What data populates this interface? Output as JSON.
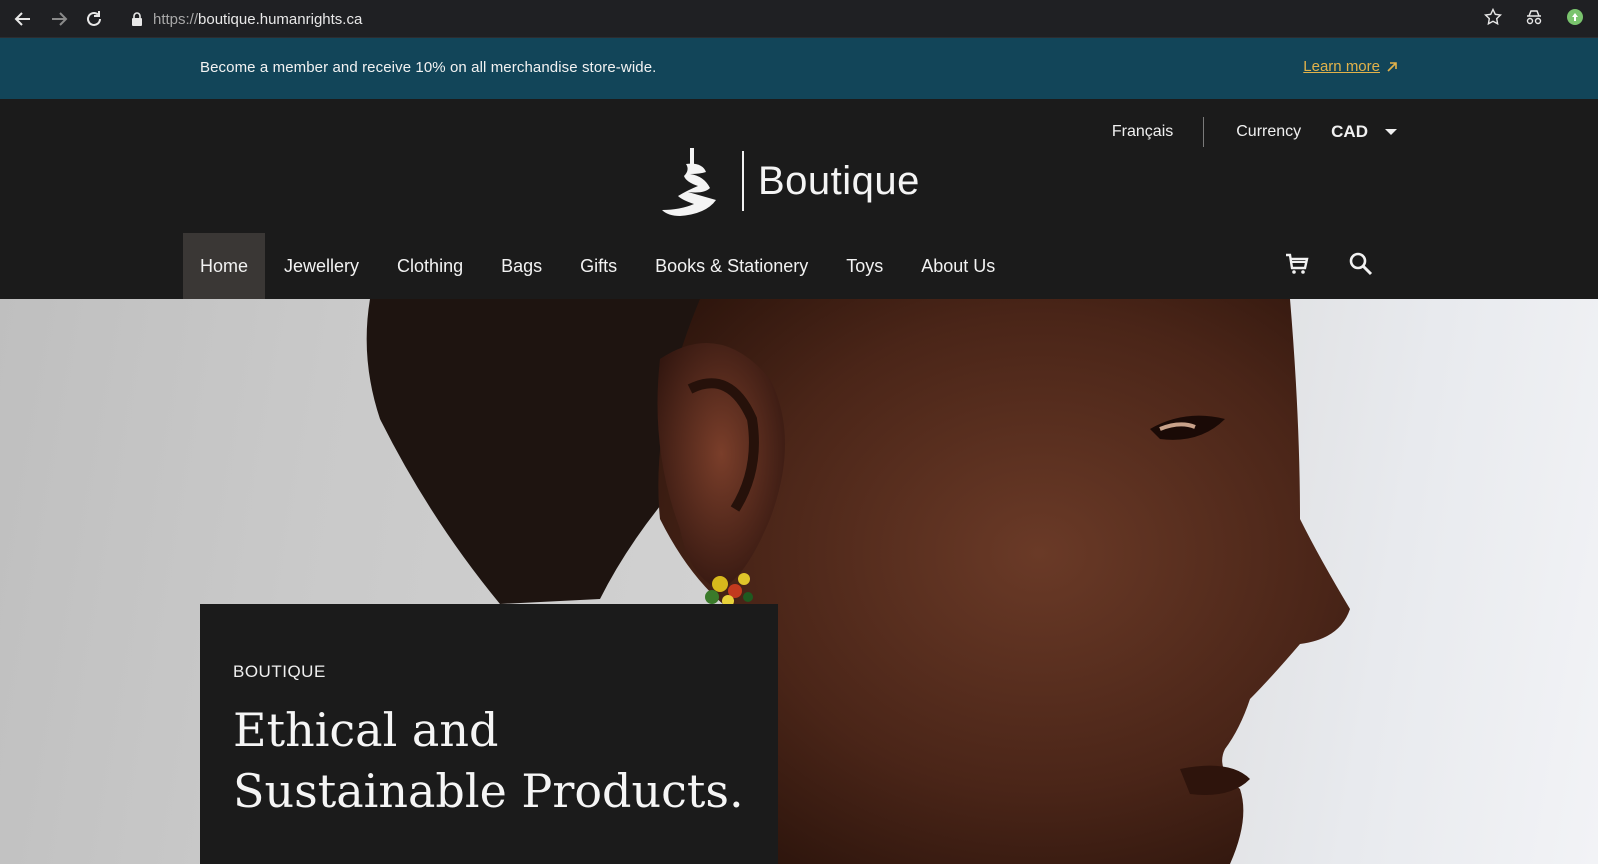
{
  "browser": {
    "url_scheme": "https://",
    "url_host": "boutique.humanrights.ca",
    "icons": [
      "back-icon",
      "forward-icon",
      "reload-icon",
      "lock-icon",
      "star-icon",
      "incognito-icon",
      "extension-icon"
    ]
  },
  "banner": {
    "message": "Become a member and receive 10% on all merchandise store-wide.",
    "link_label": "Learn more",
    "link_color": "#e2b24a",
    "background": "#124559"
  },
  "utility": {
    "language": "Français",
    "currency_label": "Currency",
    "currency_value": "CAD"
  },
  "logo": {
    "wordmark": "Boutique"
  },
  "nav": {
    "items": [
      {
        "label": "Home",
        "active": true
      },
      {
        "label": "Jewellery"
      },
      {
        "label": "Clothing"
      },
      {
        "label": "Bags"
      },
      {
        "label": "Gifts"
      },
      {
        "label": "Books & Stationery"
      },
      {
        "label": "Toys"
      },
      {
        "label": "About Us"
      }
    ],
    "icons": [
      "cart-icon",
      "search-icon"
    ]
  },
  "hero": {
    "eyebrow": "BOUTIQUE",
    "headline_line1": "Ethical and",
    "headline_line2": "Sustainable Products."
  }
}
